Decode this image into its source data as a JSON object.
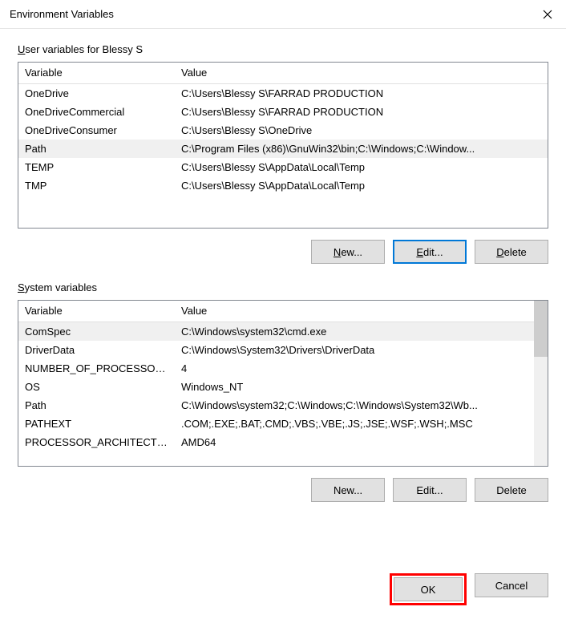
{
  "title": "Environment Variables",
  "user_section": {
    "label_prefix": "U",
    "label_rest": "ser variables for Blessy S",
    "columns": {
      "var": "Variable",
      "val": "Value"
    },
    "rows": [
      {
        "var": "OneDrive",
        "val": "C:\\Users\\Blessy S\\FARRAD PRODUCTION"
      },
      {
        "var": "OneDriveCommercial",
        "val": "C:\\Users\\Blessy S\\FARRAD PRODUCTION"
      },
      {
        "var": "OneDriveConsumer",
        "val": "C:\\Users\\Blessy S\\OneDrive"
      },
      {
        "var": "Path",
        "val": "C:\\Program Files (x86)\\GnuWin32\\bin;C:\\Windows;C:\\Window..."
      },
      {
        "var": "TEMP",
        "val": "C:\\Users\\Blessy S\\AppData\\Local\\Temp"
      },
      {
        "var": "TMP",
        "val": "C:\\Users\\Blessy S\\AppData\\Local\\Temp"
      }
    ],
    "selected_index": 3,
    "buttons": {
      "new_u": "N",
      "new_rest": "ew...",
      "edit_u": "E",
      "edit_rest": "dit...",
      "delete_u": "D",
      "delete_rest": "elete"
    }
  },
  "system_section": {
    "label_prefix": "S",
    "label_rest": "ystem variables",
    "columns": {
      "var": "Variable",
      "val": "Value"
    },
    "rows": [
      {
        "var": "ComSpec",
        "val": "C:\\Windows\\system32\\cmd.exe"
      },
      {
        "var": "DriverData",
        "val": "C:\\Windows\\System32\\Drivers\\DriverData"
      },
      {
        "var": "NUMBER_OF_PROCESSORS",
        "val": "4"
      },
      {
        "var": "OS",
        "val": "Windows_NT"
      },
      {
        "var": "Path",
        "val": "C:\\Windows\\system32;C:\\Windows;C:\\Windows\\System32\\Wb..."
      },
      {
        "var": "PATHEXT",
        "val": ".COM;.EXE;.BAT;.CMD;.VBS;.VBE;.JS;.JSE;.WSF;.WSH;.MSC"
      },
      {
        "var": "PROCESSOR_ARCHITECTU...",
        "val": "AMD64"
      }
    ],
    "selected_index": 0,
    "buttons": {
      "new": "New...",
      "edit": "Edit...",
      "delete": "Delete"
    }
  },
  "footer": {
    "ok": "OK",
    "cancel": "Cancel"
  }
}
